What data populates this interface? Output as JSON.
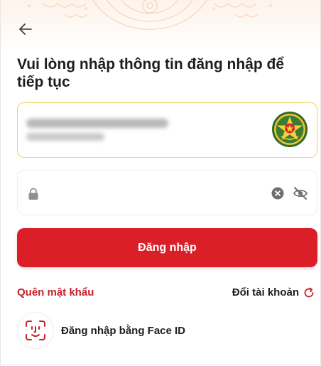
{
  "header": {
    "back_icon": "arrow-left-icon"
  },
  "title": "Vui lòng nhập thông tin đăng nhập để tiếp tục",
  "account_card": {
    "name_blurred": "",
    "phone_blurred": "",
    "badge_icon": "police-badge-icon",
    "border_color": "#f2d35c"
  },
  "password_field": {
    "value": "",
    "placeholder": "",
    "lock_icon": "lock-icon",
    "clear_icon": "clear-circle-icon",
    "visibility_icon": "eye-off-icon"
  },
  "login_button": {
    "label": "Đăng nhập",
    "color": "#da1f28"
  },
  "links": {
    "forgot_password": "Quên mật khẩu",
    "switch_account": "Đổi tài khoản",
    "switch_icon": "refresh-icon",
    "accent_color": "#c8202a"
  },
  "face_id": {
    "label": "Đăng nhập bằng Face ID",
    "icon": "face-id-icon"
  }
}
